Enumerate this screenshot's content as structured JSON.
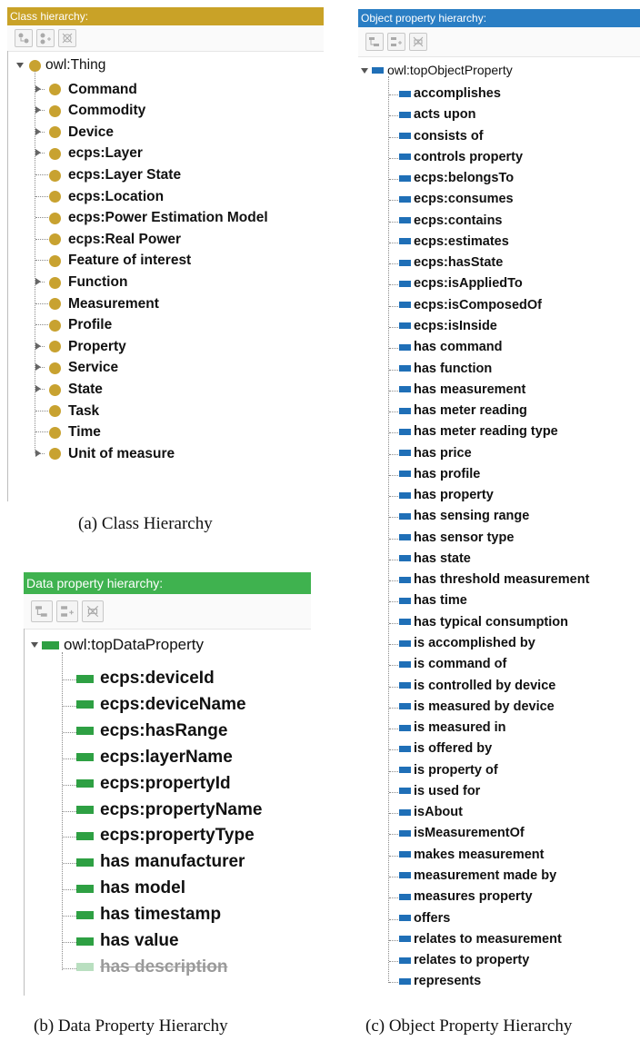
{
  "class_panel": {
    "title": "Class hierarchy:",
    "header_color": "#c9a227",
    "toolbar": [
      "add-subclass-icon",
      "add-sibling-icon",
      "delete-icon"
    ],
    "root": "owl:Thing",
    "items": [
      {
        "label": "Command",
        "expandable": true
      },
      {
        "label": "Commodity",
        "expandable": true
      },
      {
        "label": "Device",
        "expandable": true
      },
      {
        "label": "ecps:Layer",
        "expandable": true
      },
      {
        "label": "ecps:Layer State",
        "expandable": false
      },
      {
        "label": "ecps:Location",
        "expandable": false
      },
      {
        "label": "ecps:Power Estimation Model",
        "expandable": false
      },
      {
        "label": "ecps:Real Power",
        "expandable": false
      },
      {
        "label": "Feature of interest",
        "expandable": false
      },
      {
        "label": "Function",
        "expandable": true
      },
      {
        "label": "Measurement",
        "expandable": false
      },
      {
        "label": "Profile",
        "expandable": false
      },
      {
        "label": "Property",
        "expandable": true
      },
      {
        "label": "Service",
        "expandable": true
      },
      {
        "label": "State",
        "expandable": true
      },
      {
        "label": "Task",
        "expandable": false
      },
      {
        "label": "Time",
        "expandable": false
      },
      {
        "label": "Unit of measure",
        "expandable": true
      }
    ],
    "caption": "(a) Class Hierarchy"
  },
  "data_panel": {
    "title": "Data property hierarchy:",
    "header_color": "#3fb24f",
    "toolbar": [
      "add-subproperty-icon",
      "add-sibling-icon",
      "delete-icon"
    ],
    "root": "owl:topDataProperty",
    "items": [
      {
        "label": "ecps:deviceId",
        "faded": false
      },
      {
        "label": "ecps:deviceName",
        "faded": false
      },
      {
        "label": "ecps:hasRange",
        "faded": false
      },
      {
        "label": "ecps:layerName",
        "faded": false
      },
      {
        "label": "ecps:propertyId",
        "faded": false
      },
      {
        "label": "ecps:propertyName",
        "faded": false
      },
      {
        "label": "ecps:propertyType",
        "faded": false
      },
      {
        "label": "has manufacturer",
        "faded": false
      },
      {
        "label": "has model",
        "faded": false
      },
      {
        "label": "has timestamp",
        "faded": false
      },
      {
        "label": "has value",
        "faded": false
      },
      {
        "label": "has description",
        "faded": true
      }
    ],
    "caption": "(b) Data Property Hierarchy"
  },
  "object_panel": {
    "title": "Object property hierarchy:",
    "header_color": "#2a7ec4",
    "toolbar": [
      "add-subproperty-icon",
      "add-sibling-icon",
      "delete-icon"
    ],
    "root": "owl:topObjectProperty",
    "items": [
      "accomplishes",
      "acts upon",
      "consists of",
      "controls property",
      "ecps:belongsTo",
      "ecps:consumes",
      "ecps:contains",
      "ecps:estimates",
      "ecps:hasState",
      "ecps:isAppliedTo",
      "ecps:isComposedOf",
      "ecps:isInside",
      "has command",
      "has function",
      "has measurement",
      "has meter reading",
      "has meter reading type",
      "has price",
      "has profile",
      "has property",
      "has sensing range",
      "has sensor type",
      "has state",
      "has threshold measurement",
      "has time",
      "has typical consumption",
      "is accomplished by",
      "is command of",
      "is controlled by device",
      "is measured by device",
      "is measured in",
      "is offered by",
      "is property of",
      "is used for",
      "isAbout",
      "isMeasurementOf",
      "makes measurement",
      "measurement made by",
      "measures property",
      "offers",
      "relates to measurement",
      "relates to property",
      "represents"
    ],
    "caption": "(c) Object Property Hierarchy"
  }
}
